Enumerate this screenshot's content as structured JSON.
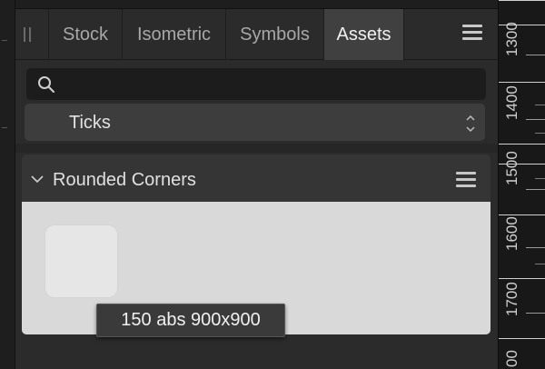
{
  "tabs": [
    {
      "label": "Stock"
    },
    {
      "label": "Isometric"
    },
    {
      "label": "Symbols"
    },
    {
      "label": "Assets"
    }
  ],
  "active_tab": "Assets",
  "search": {
    "value": "",
    "placeholder": ""
  },
  "category_dropdown": {
    "selected": "Ticks"
  },
  "section": {
    "title": "Rounded Corners",
    "expanded": true
  },
  "asset_tooltip": "150 abs 900x900",
  "ruler": {
    "labels": [
      "1300",
      "1400",
      "1500",
      "1600",
      "1700",
      "00"
    ]
  },
  "colors": {
    "panel": "#2b2b2b",
    "active_tab": "#404040",
    "section_body": "#d9d9d9",
    "ruler": "#181818"
  },
  "icons": {
    "grip": "grip-icon",
    "panel_menu": "hamburger-menu-icon",
    "search": "search-icon",
    "dropdown": "updown-chevron-icon",
    "section_toggle": "chevron-down-icon",
    "section_menu": "hamburger-menu-icon"
  }
}
